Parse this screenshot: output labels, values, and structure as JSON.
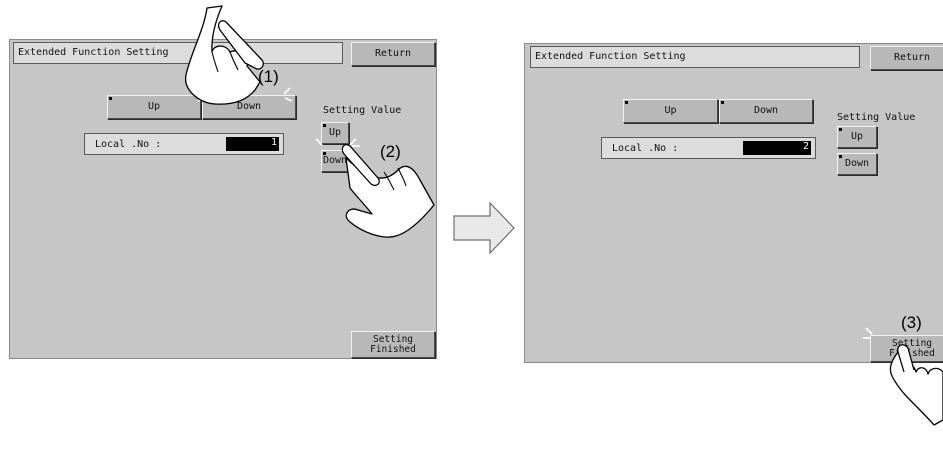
{
  "left_screen": {
    "title": "Extended Function Setting",
    "return_label": "Return",
    "up_label": "Up",
    "down_label": "Down",
    "field_label": "Local .No :",
    "field_value": "1",
    "setting_value_label": "Setting Value",
    "sv_up_label": "Up",
    "sv_down_label": "Down",
    "finish_label": "Setting\nFinished"
  },
  "right_screen": {
    "title": "Extended Function Setting",
    "return_label": "Return",
    "up_label": "Up",
    "down_label": "Down",
    "field_label": "Local .No :",
    "field_value": "2",
    "setting_value_label": "Setting Value",
    "sv_up_label": "Up",
    "sv_down_label": "Down",
    "finish_label": "Setting\nFinished"
  },
  "steps": {
    "step1": "(1)",
    "step2": "(2)",
    "step3": "(3)"
  },
  "icons": {
    "hand": "pointing-hand-icon",
    "arrow": "right-arrow-icon",
    "tap": "tap-burst-icon"
  },
  "colors": {
    "panel": "#c6c6c6",
    "button": "#b8b8b8",
    "value_bg": "#000000"
  }
}
